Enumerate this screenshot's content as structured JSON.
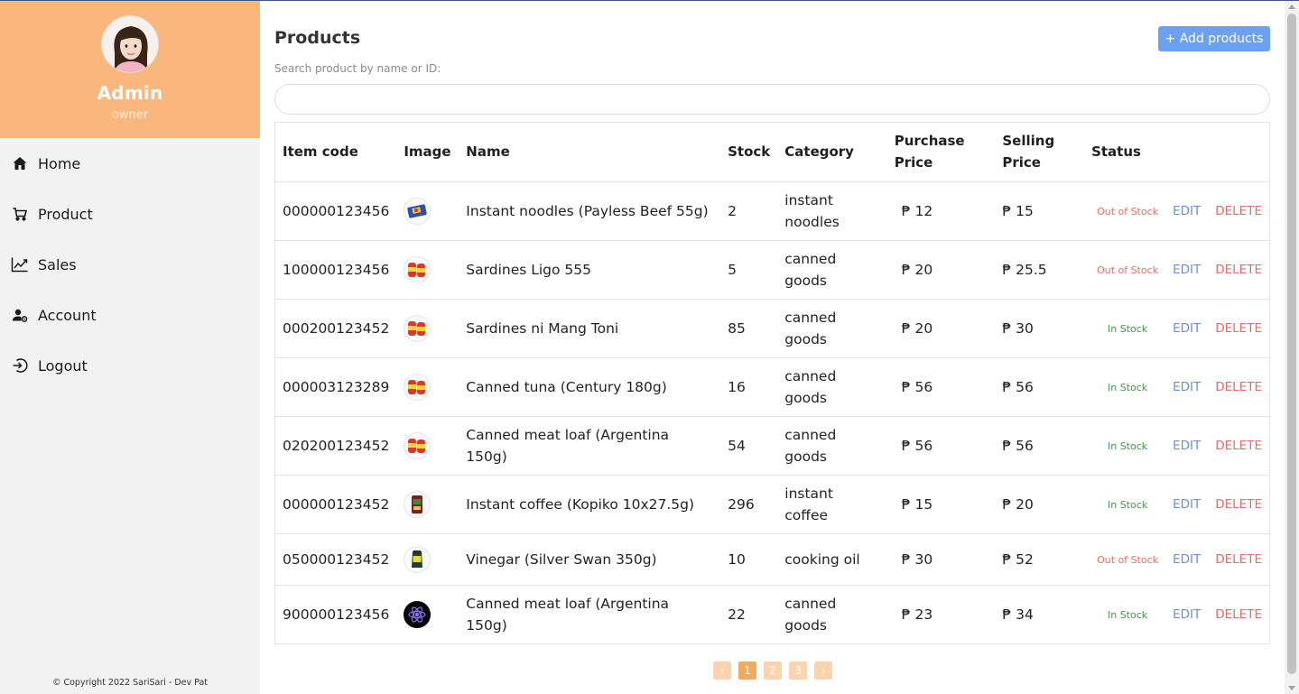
{
  "sidebar": {
    "name": "Admin",
    "role": "owner",
    "nav": [
      {
        "label": "Home",
        "icon": "home-icon"
      },
      {
        "label": "Product",
        "icon": "cart-icon"
      },
      {
        "label": "Sales",
        "icon": "trend-chart-icon"
      },
      {
        "label": "Account",
        "icon": "user-gear-icon"
      },
      {
        "label": "Logout",
        "icon": "logout-icon"
      }
    ],
    "copyright": "© Copyright 2022 SariSari - Dev Pat"
  },
  "header": {
    "title": "Products",
    "add_button": "+ Add products",
    "search_label": "Search product by name or ID:",
    "search_value": ""
  },
  "table": {
    "headers": {
      "item_code": "Item code",
      "image": "Image",
      "name": "Name",
      "stock": "Stock",
      "category": "Category",
      "purchase_1": "Purchase",
      "purchase_2": "Price",
      "selling_1": "Selling",
      "selling_2": "Price",
      "status": "Status"
    },
    "edit_label": "EDIT",
    "delete_label": "DELETE",
    "rows": [
      {
        "code": "000000123456",
        "name": "Instant noodles (Payless Beef 55g)",
        "stock": "2",
        "category": "instant noodles",
        "purchase": "₱ 12",
        "selling": "₱ 15",
        "status": "Out of Stock"
      },
      {
        "code": "100000123456",
        "name": "Sardines Ligo 555",
        "stock": "5",
        "category": "canned goods",
        "purchase": "₱ 20",
        "selling": "₱ 25.5",
        "status": "Out of Stock"
      },
      {
        "code": "000200123452",
        "name": "Sardines ni Mang Toni",
        "stock": "85",
        "category": "canned goods",
        "purchase": "₱ 20",
        "selling": "₱ 30",
        "status": "In Stock"
      },
      {
        "code": "000003123289",
        "name": "Canned tuna (Century 180g)",
        "stock": "16",
        "category": "canned goods",
        "purchase": "₱ 56",
        "selling": "₱ 56",
        "status": "In Stock"
      },
      {
        "code": "020200123452",
        "name": "Canned meat loaf (Argentina 150g)",
        "stock": "54",
        "category": "canned goods",
        "purchase": "₱ 56",
        "selling": "₱ 56",
        "status": "In Stock"
      },
      {
        "code": "000000123452",
        "name": "Instant coffee (Kopiko 10x27.5g)",
        "stock": "296",
        "category": "instant coffee",
        "purchase": "₱ 15",
        "selling": "₱ 20",
        "status": "In Stock"
      },
      {
        "code": "050000123452",
        "name": "Vinegar (Silver Swan 350g)",
        "stock": "10",
        "category": "cooking oil",
        "purchase": "₱ 30",
        "selling": "₱ 52",
        "status": "Out of Stock"
      },
      {
        "code": "900000123456",
        "name": "Canned meat loaf (Argentina 150g)",
        "stock": "22",
        "category": "canned goods",
        "purchase": "₱ 23",
        "selling": "₱ 34",
        "status": "In Stock"
      }
    ]
  },
  "pagination": {
    "prev": "‹",
    "pages": [
      "1",
      "2",
      "3"
    ],
    "next": "›",
    "current": "1"
  },
  "colors": {
    "accent": "#f9b77d",
    "button": "#6ca0f5",
    "out_of_stock": "#ea6d60",
    "in_stock": "#3f9a4a",
    "edit": "#6b8fd6",
    "delete": "#e76b6b"
  }
}
